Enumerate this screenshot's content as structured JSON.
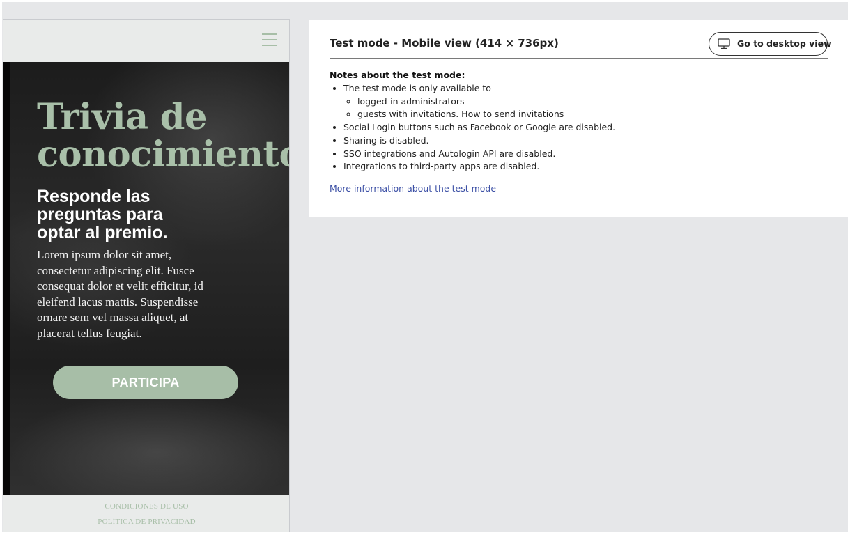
{
  "mobile_preview": {
    "menu_icon": "hamburger-menu-icon",
    "hero": {
      "title": "Trivia de conocimientos",
      "subtitle": "Responde las preguntas para optar al premio.",
      "body": "Lorem ipsum dolor sit amet, consectetur adipiscing elit. Fusce consequat dolor et velit efficitur, id eleifend lacus mattis. Suspendisse ornare sem vel massa aliquet, at placerat tellus feugiat.",
      "cta_label": "PARTICIPA"
    },
    "footer": {
      "terms_label": "CONDICIONES DE USO",
      "privacy_label": "POLÍTICA DE PRIVACIDAD"
    }
  },
  "test_panel": {
    "title": "Test mode - Mobile view (414 × 736px)",
    "desktop_button": {
      "label": "Go to desktop view",
      "icon": "monitor-icon"
    },
    "notes_heading": "Notes about the test mode:",
    "notes": {
      "availability": "The test mode is only available to",
      "availability_items": [
        "logged-in administrators",
        "guests with invitations. How to send invitations"
      ],
      "social_login": "Social Login buttons such as Facebook or Google are disabled.",
      "sharing": "Sharing is disabled.",
      "sso": "SSO integrations and Autologin API are disabled.",
      "integrations": "Integrations to third-party apps are disabled."
    },
    "more_info_link": "More information about the test mode"
  },
  "colors": {
    "accent_green": "#a7bea7",
    "link_blue": "#3b4fa5",
    "background_gray": "#e6e7e9"
  }
}
